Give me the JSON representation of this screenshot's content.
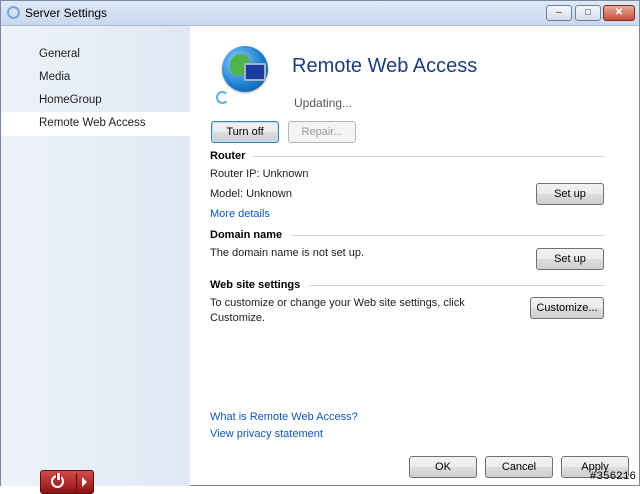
{
  "window": {
    "title": "Server Settings",
    "minimize_glyph": "–",
    "maximize_glyph": "□",
    "close_glyph": "✕"
  },
  "sidebar": {
    "items": [
      {
        "label": "General"
      },
      {
        "label": "Media"
      },
      {
        "label": "HomeGroup"
      },
      {
        "label": "Remote Web Access"
      }
    ],
    "active_index": 3
  },
  "main": {
    "title": "Remote Web Access",
    "status": "Updating...",
    "turn_off_label": "Turn off",
    "repair_label": "Repair...",
    "router": {
      "heading": "Router",
      "ip_text": "Router IP: Unknown",
      "model_text": "Model: Unknown",
      "setup_label": "Set up",
      "more_details": "More details"
    },
    "domain": {
      "heading": "Domain name",
      "text": "The domain name is not set up.",
      "setup_label": "Set up"
    },
    "website": {
      "heading": "Web site settings",
      "text_line1": "To customize or change your Web site settings, click",
      "text_line2": "Customize.",
      "customize_label": "Customize..."
    },
    "links": {
      "what_is": "What is Remote Web Access?",
      "privacy": "View privacy statement"
    }
  },
  "footer": {
    "ok_label": "OK",
    "cancel_label": "Cancel",
    "apply_label": "Apply"
  },
  "watermark": "#356216",
  "colors": {
    "title_blue": "#1c3e7a",
    "link_blue": "#0e57b5",
    "power_red": "#b02020"
  }
}
